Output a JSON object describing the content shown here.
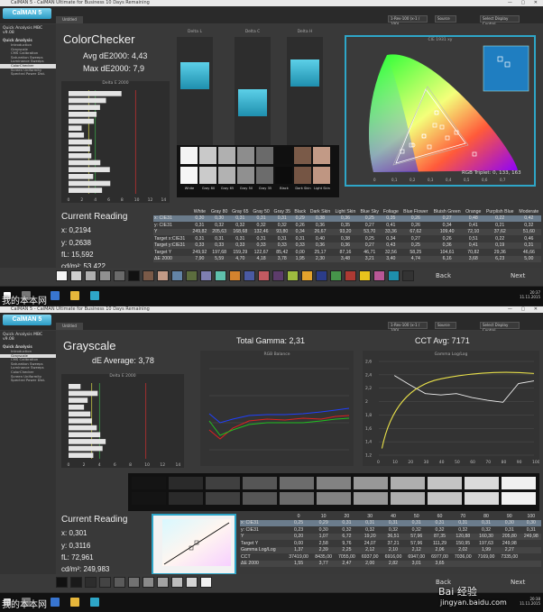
{
  "watermark_text": "我的本本网",
  "baidu_text": "Bai 经验",
  "baidu_url": "jingyan.baidu.com",
  "app": {
    "logo": "CalMAN 5",
    "titlebar": "CalMAN 5 - CalMAN Ultimate for Business 10 Days Remaining",
    "tab": "Untitled",
    "source_dd": "1-Rev-100 (x-1 / 100)",
    "meter_dd": "Source",
    "display_dd": "Select Display Control",
    "sidebar_head": "Quick Analysis MBC v9.08",
    "sidebar_section": "Quick Analysis",
    "sidebar_items": [
      "Introduction",
      "Grayscale",
      "CMS Calibration",
      "Saturation Sweeps",
      "Luminance Sweeps",
      "ColorChecker",
      "Screen Uniformity",
      "Spectral Power Dist."
    ],
    "next_label": "Next",
    "back_label": "Back",
    "clock1": "20:37\n11.11.2015",
    "clock2": "20:38\n11.11.2015"
  },
  "screen1": {
    "title": "ColorChecker",
    "avg_de": "Avg dE2000: 4,43",
    "max_de": "Max dE2000: 7,9",
    "delta_chart_label": "Delta E 2000",
    "bar_labels": [
      "Delta L",
      "Delta C",
      "Delta H"
    ],
    "cie_label": "CIE 1931 xy",
    "rgb_triplet": "RGB Triplet: 0, 133, 163",
    "swatch_row_labels": [
      "Actual",
      "Target"
    ],
    "swatch_names": [
      "White",
      "Gray 80",
      "Gray 65",
      "Gray 50",
      "Gray 35",
      "Black",
      "Dark Skin",
      "Light Skin"
    ],
    "reading": {
      "title": "Current Reading",
      "x": "x: 0,2194",
      "y": "y: 0,2638",
      "fl": "fL: 15,592",
      "cdm2": "cd/m²: 53,422"
    },
    "table": {
      "headers": [
        "",
        "White",
        "Gray 80",
        "Gray 65",
        "Gray 50",
        "Gray 35",
        "Black",
        "Dark Skin",
        "Light Skin",
        "Blue Sky",
        "Foliage",
        "Blue Flower",
        "Bluish Green",
        "Orange",
        "Purplish Blue",
        "Moderate"
      ],
      "rows": [
        [
          "x: CIE31",
          "0,30",
          "0,30",
          "0,31",
          "0,31",
          "0,31",
          "0,29",
          "0,38",
          "0,36",
          "0,25",
          "0,35",
          "0,26",
          "0,27",
          "0,48",
          "0,22",
          "0,42"
        ],
        [
          "y: CIE31",
          "0,31",
          "0,32",
          "0,32",
          "0,32",
          "0,32",
          "0,26",
          "0,36",
          "0,35",
          "0,27",
          "0,41",
          "0,26",
          "0,34",
          "0,41",
          "0,21",
          "0,32"
        ],
        [
          "Y",
          "249,82",
          "205,63",
          "168,68",
          "132,46",
          "93,80",
          "0,34",
          "26,67",
          "93,20",
          "53,70",
          "33,36",
          "67,62",
          "109,40",
          "72,10",
          "37,62",
          "51,60"
        ],
        [
          "Target x:CIE31",
          "0,31",
          "0,31",
          "0,31",
          "0,31",
          "0,31",
          "0,31",
          "0,40",
          "0,38",
          "0,25",
          "0,34",
          "0,27",
          "0,26",
          "0,51",
          "0,22",
          "0,46"
        ],
        [
          "Target y:CIE31",
          "0,33",
          "0,33",
          "0,33",
          "0,33",
          "0,33",
          "0,33",
          "0,36",
          "0,36",
          "0,27",
          "0,43",
          "0,25",
          "0,36",
          "0,41",
          "0,19",
          "0,31"
        ],
        [
          "Target Y",
          "249,92",
          "197,68",
          "159,29",
          "122,67",
          "85,42",
          "0,00",
          "25,17",
          "87,16",
          "46,71",
          "32,56",
          "58,25",
          "104,61",
          "70,82",
          "29,36",
          "46,66"
        ],
        [
          "ΔE 2000",
          "7,90",
          "5,59",
          "4,70",
          "4,18",
          "3,78",
          "1,95",
          "2,30",
          "3,48",
          "3,21",
          "3,40",
          "4,74",
          "6,16",
          "3,68",
          "6,23",
          "5,00"
        ]
      ]
    }
  },
  "screen2": {
    "title": "Grayscale",
    "de_avg": "dE Average: 3,78",
    "total_gamma": "Total Gamma: 2,31",
    "cct_avg": "CCT Avg: 7171",
    "delta_chart_label": "Delta E 2000",
    "rgb_balance_label": "RGB Balance",
    "gamma_label": "Gamma Log/Log",
    "swatch_row_labels": [
      "Actual",
      "Target"
    ],
    "reading": {
      "title": "Current Reading",
      "x": "x: 0,301",
      "y": "y: 0,3116",
      "fl": "fL: 72,961",
      "cdm2": "cd/m²: 249,983"
    },
    "table": {
      "headers": [
        "",
        "0",
        "10",
        "20",
        "30",
        "40",
        "50",
        "60",
        "70",
        "80",
        "90",
        "100"
      ],
      "rows": [
        [
          "x: CIE31",
          "0,25",
          "0,29",
          "0,31",
          "0,31",
          "0,31",
          "0,31",
          "0,31",
          "0,31",
          "0,31",
          "0,30",
          "0,30"
        ],
        [
          "y: CIE31",
          "0,23",
          "0,30",
          "0,32",
          "0,32",
          "0,32",
          "0,32",
          "0,32",
          "0,32",
          "0,32",
          "0,31",
          "0,31"
        ],
        [
          "Y",
          "0,20",
          "1,07",
          "6,72",
          "19,20",
          "36,51",
          "57,96",
          "87,35",
          "120,88",
          "160,30",
          "205,80",
          "249,98"
        ],
        [
          "Target Y",
          "0,00",
          "2,58",
          "9,76",
          "24,07",
          "37,21",
          "57,96",
          "111,29",
          "150,95",
          "197,63",
          "249,98",
          ""
        ],
        [
          "Gamma Log/Log",
          "1,37",
          "2,39",
          "2,25",
          "2,12",
          "2,10",
          "2,12",
          "2,06",
          "2,02",
          "1,99",
          "2,27",
          ""
        ],
        [
          "CCT",
          "37419,00",
          "8435,00",
          "7055,00",
          "6937,00",
          "6916,00",
          "6947,00",
          "6977,00",
          "7036,00",
          "7169,00",
          "7335,00",
          ""
        ],
        [
          "ΔE 2000",
          "1,55",
          "3,77",
          "2,47",
          "2,00",
          "2,82",
          "3,01",
          "3,65",
          "",
          "",
          "",
          ""
        ]
      ]
    }
  },
  "chart_data": [
    {
      "type": "bar",
      "title": "Delta E 2000",
      "series": [
        {
          "values": [
            7.9,
            5.59,
            4.7,
            4.18,
            3.78,
            1.95,
            2.3,
            3.48,
            3.21,
            3.4,
            4.74,
            6.16,
            3.68,
            6.23,
            5.0
          ]
        }
      ],
      "orientation": "horizontal",
      "xlim": [
        0,
        14
      ],
      "x_ticks": [
        "0",
        "2",
        "4",
        "6",
        "8",
        "10",
        "12",
        "14"
      ]
    },
    {
      "type": "bar",
      "title": "Delta E 2000",
      "series": [
        {
          "values": [
            1.55,
            3.77,
            2.47,
            2.0,
            2.82,
            3.01,
            3.65,
            4.1,
            4.8,
            4.4,
            3.2
          ]
        }
      ],
      "orientation": "horizontal",
      "xlim": [
        0,
        14
      ],
      "x_ticks": [
        "0",
        "2",
        "4",
        "6",
        "8",
        "10",
        "12",
        "14"
      ]
    },
    {
      "type": "line",
      "title": "Gamma Log/Log",
      "x": [
        10,
        20,
        30,
        40,
        50,
        60,
        70,
        80,
        90,
        100
      ],
      "series": [
        {
          "values": [
            2.39,
            2.25,
            2.12,
            2.1,
            2.12,
            2.06,
            2.02,
            1.99,
            2.27,
            2.31
          ]
        }
      ],
      "ylim": [
        1.2,
        2.6
      ],
      "y_ticks": [
        "1,2",
        "1,4",
        "1,6",
        "1,8",
        "2",
        "2,2",
        "2,4",
        "2,6"
      ],
      "x_ticks": [
        "0",
        "10",
        "20",
        "30",
        "40",
        "50",
        "60",
        "70",
        "80",
        "90",
        "100"
      ]
    }
  ],
  "colors": {
    "accent": "#2ea6c8",
    "panel_bg": "#393939",
    "cyan_bar": "#3ab5d0"
  }
}
